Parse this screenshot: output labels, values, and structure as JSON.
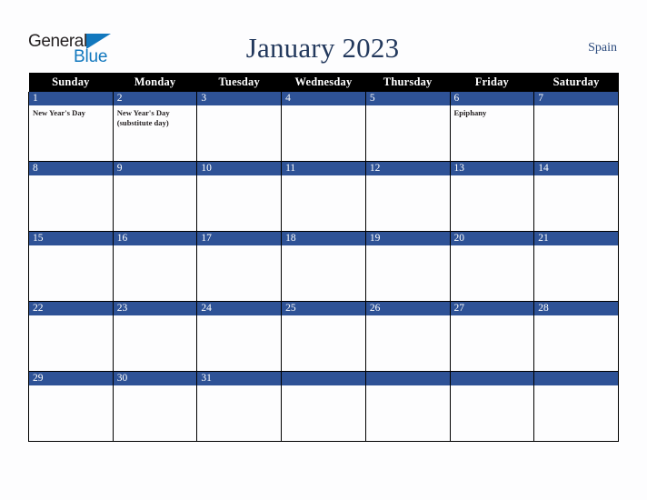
{
  "logo": {
    "text_top": "General",
    "text_bottom": "Blue",
    "triangle_color": "#1278be",
    "top_color": "#231f20"
  },
  "header": {
    "title": "January 2023",
    "country": "Spain",
    "title_color": "#23395d",
    "country_color": "#2b4a7d"
  },
  "calendar": {
    "weekday_headers": [
      "Sunday",
      "Monday",
      "Tuesday",
      "Wednesday",
      "Thursday",
      "Friday",
      "Saturday"
    ],
    "header_bg": "#000000",
    "daynum_band_color": "#2e5296",
    "weeks": [
      [
        {
          "day": "1",
          "events": [
            "New Year's Day"
          ]
        },
        {
          "day": "2",
          "events": [
            "New Year's Day (substitute day)"
          ]
        },
        {
          "day": "3",
          "events": []
        },
        {
          "day": "4",
          "events": []
        },
        {
          "day": "5",
          "events": []
        },
        {
          "day": "6",
          "events": [
            "Epiphany"
          ]
        },
        {
          "day": "7",
          "events": []
        }
      ],
      [
        {
          "day": "8",
          "events": []
        },
        {
          "day": "9",
          "events": []
        },
        {
          "day": "10",
          "events": []
        },
        {
          "day": "11",
          "events": []
        },
        {
          "day": "12",
          "events": []
        },
        {
          "day": "13",
          "events": []
        },
        {
          "day": "14",
          "events": []
        }
      ],
      [
        {
          "day": "15",
          "events": []
        },
        {
          "day": "16",
          "events": []
        },
        {
          "day": "17",
          "events": []
        },
        {
          "day": "18",
          "events": []
        },
        {
          "day": "19",
          "events": []
        },
        {
          "day": "20",
          "events": []
        },
        {
          "day": "21",
          "events": []
        }
      ],
      [
        {
          "day": "22",
          "events": []
        },
        {
          "day": "23",
          "events": []
        },
        {
          "day": "24",
          "events": []
        },
        {
          "day": "25",
          "events": []
        },
        {
          "day": "26",
          "events": []
        },
        {
          "day": "27",
          "events": []
        },
        {
          "day": "28",
          "events": []
        }
      ],
      [
        {
          "day": "29",
          "events": []
        },
        {
          "day": "30",
          "events": []
        },
        {
          "day": "31",
          "events": []
        },
        {
          "day": "",
          "events": []
        },
        {
          "day": "",
          "events": []
        },
        {
          "day": "",
          "events": []
        },
        {
          "day": "",
          "events": []
        }
      ]
    ]
  }
}
